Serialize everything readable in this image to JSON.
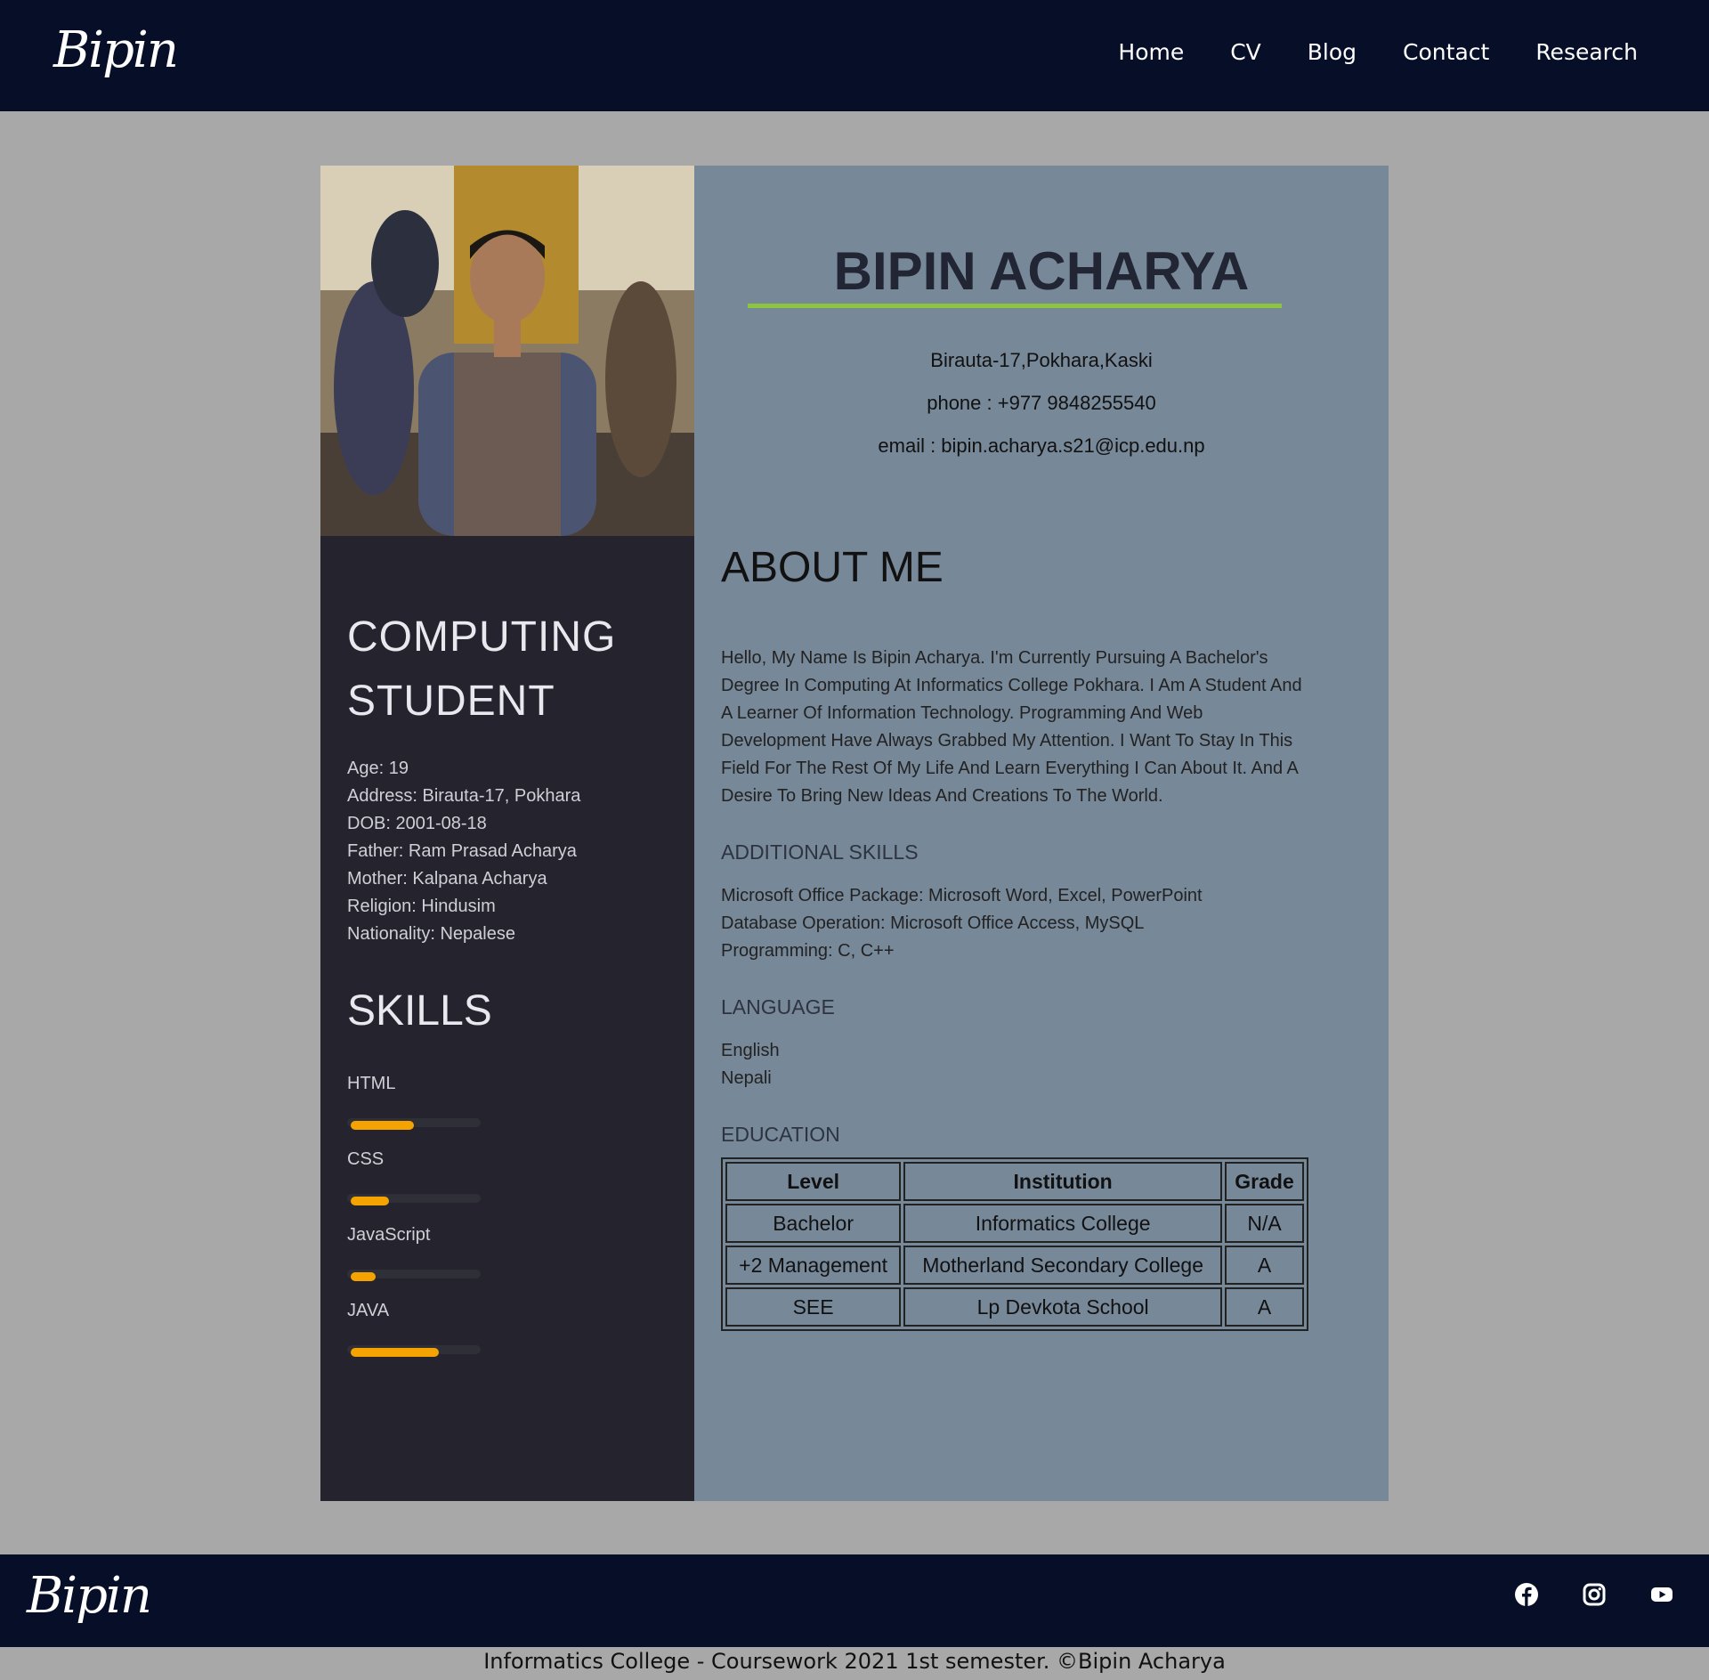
{
  "header": {
    "logo": "Bipin",
    "nav": [
      "Home",
      "CV",
      "Blog",
      "Contact",
      "Research"
    ]
  },
  "profile": {
    "name": "BIPIN ACHARYA",
    "address_line": "Birauta-17,Pokhara,Kaski",
    "phone_line": "phone : +977 9848255540",
    "email_line": "email : bipin.acharya.s21@icp.edu.np"
  },
  "sidebar": {
    "role_line1": "COMPUTING",
    "role_line2": "STUDENT",
    "info": [
      "Age: 19",
      "Address: Birauta-17, Pokhara",
      "DOB: 2001-08-18",
      "Father: Ram Prasad Acharya",
      "Mother: Kalpana Acharya",
      "Religion: Hindusim",
      "Nationality: Nepalese"
    ],
    "skills_heading": "SKILLS",
    "skills": [
      {
        "label": "HTML",
        "level": 0.5
      },
      {
        "label": "CSS",
        "level": 0.3
      },
      {
        "label": "JavaScript",
        "level": 0.2
      },
      {
        "label": "JAVA",
        "level": 0.7
      }
    ]
  },
  "about": {
    "heading": "ABOUT ME",
    "text": "Hello, My Name Is Bipin Acharya. I'm Currently Pursuing A Bachelor's Degree In Computing At Informatics College Pokhara. I Am A Student And A Learner Of Information Technology. Programming And Web Development Have Always Grabbed My Attention. I Want To Stay In This Field For The Rest Of My Life And Learn Everything I Can About It. And A Desire To Bring New Ideas And Creations To The World."
  },
  "additional_skills": {
    "heading": "ADDITIONAL SKILLS",
    "items": [
      "Microsoft Office Package: Microsoft Word, Excel, PowerPoint",
      "Database Operation: Microsoft Office Access, MySQL",
      "Programming: C, C++"
    ]
  },
  "language": {
    "heading": "LANGUAGE",
    "items": [
      "English",
      "Nepali"
    ]
  },
  "education": {
    "heading": "EDUCATION",
    "columns": [
      "Level",
      "Institution",
      "Grade"
    ],
    "rows": [
      [
        "Bachelor",
        "Informatics College",
        "N/A"
      ],
      [
        "+2 Management",
        "Motherland Secondary College",
        "A"
      ],
      [
        "SEE",
        "Lp Devkota School",
        "A"
      ]
    ]
  },
  "footer": {
    "logo": "Bipin",
    "social_icons": [
      "facebook-icon",
      "instagram-icon",
      "youtube-icon"
    ],
    "copyright": "Informatics College - Coursework 2021 1st semester. ©Bipin Acharya"
  },
  "colors": {
    "navbar": "#070e28",
    "page_bg": "#a8a8a8",
    "sidebar_bg": "#25242e",
    "main_bg": "#778899",
    "accent_underline": "#8cc63f",
    "skill_bar": "#f5a300"
  }
}
